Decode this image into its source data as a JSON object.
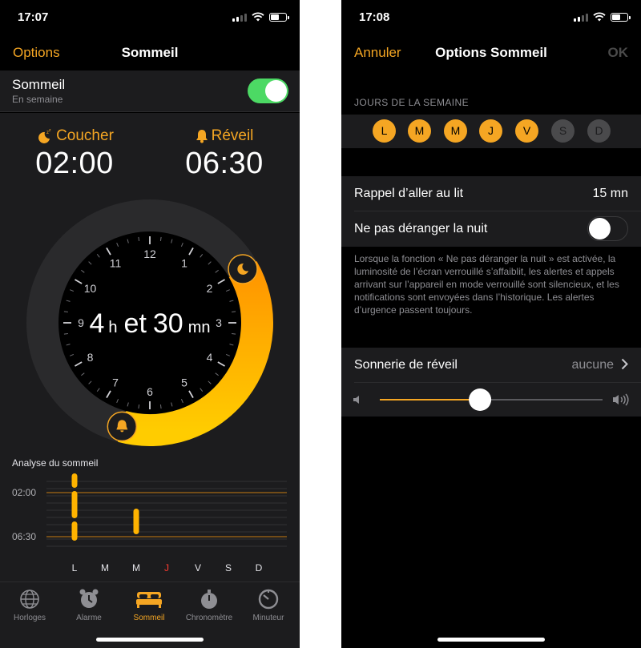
{
  "left": {
    "status": {
      "time": "17:07"
    },
    "nav": {
      "left": "Options",
      "title": "Sommeil"
    },
    "sleep_row": {
      "title": "Sommeil",
      "subtitle": "En semaine",
      "enabled": true
    },
    "bedtime": {
      "label": "Coucher",
      "value": "02:00"
    },
    "wake": {
      "label": "Réveil",
      "value": "06:30"
    },
    "duration": {
      "hours": "4",
      "h_unit": "h",
      "et": "et",
      "minutes": "30",
      "m_unit": "mn"
    },
    "clock_numbers": [
      "12",
      "1",
      "2",
      "3",
      "4",
      "5",
      "6",
      "7",
      "8",
      "9",
      "10",
      "11"
    ],
    "analysis": {
      "title": "Analyse du sommeil",
      "y_labels": [
        "02:00",
        "06:30"
      ],
      "days": [
        "L",
        "M",
        "M",
        "J",
        "V",
        "S",
        "D"
      ],
      "highlight_day_color": "#ff3b30",
      "highlight_day_index": 3
    },
    "tabs": [
      {
        "label": "Horloges",
        "icon": "globe-icon"
      },
      {
        "label": "Alarme",
        "icon": "alarm-clock-icon"
      },
      {
        "label": "Sommeil",
        "icon": "bed-icon"
      },
      {
        "label": "Chronomètre",
        "icon": "stopwatch-icon"
      },
      {
        "label": "Minuteur",
        "icon": "timer-icon"
      }
    ],
    "active_tab": "Sommeil"
  },
  "right": {
    "status": {
      "time": "17:08"
    },
    "nav": {
      "left": "Annuler",
      "title": "Options Sommeil",
      "right": "OK"
    },
    "days_header": "JOURS DE LA SEMAINE",
    "days": [
      {
        "letter": "L",
        "on": true
      },
      {
        "letter": "M",
        "on": true
      },
      {
        "letter": "M",
        "on": true
      },
      {
        "letter": "J",
        "on": true
      },
      {
        "letter": "V",
        "on": true
      },
      {
        "letter": "S",
        "on": false
      },
      {
        "letter": "D",
        "on": false
      }
    ],
    "reminder": {
      "label": "Rappel d’aller au lit",
      "value": "15 mn"
    },
    "dnd": {
      "label": "Ne pas déranger la nuit",
      "enabled": false
    },
    "dnd_note": "Lorsque la fonction « Ne pas déranger la nuit » est activée, la luminosité de l’écran verrouillé s’affaiblit, les alertes et appels arrivant sur l’appareil en mode verrouillé sont silencieux, et les notifications sont envoyées dans l’historique. Les alertes d’urgence passent toujours.",
    "ringtone": {
      "label": "Sonnerie de réveil",
      "value": "aucune"
    },
    "volume": 0.45
  },
  "colors": {
    "accent": "#f5a623",
    "switch_on": "#4cd964",
    "cell": "#1c1c1e",
    "inactive_day": "#4a4a4c"
  }
}
